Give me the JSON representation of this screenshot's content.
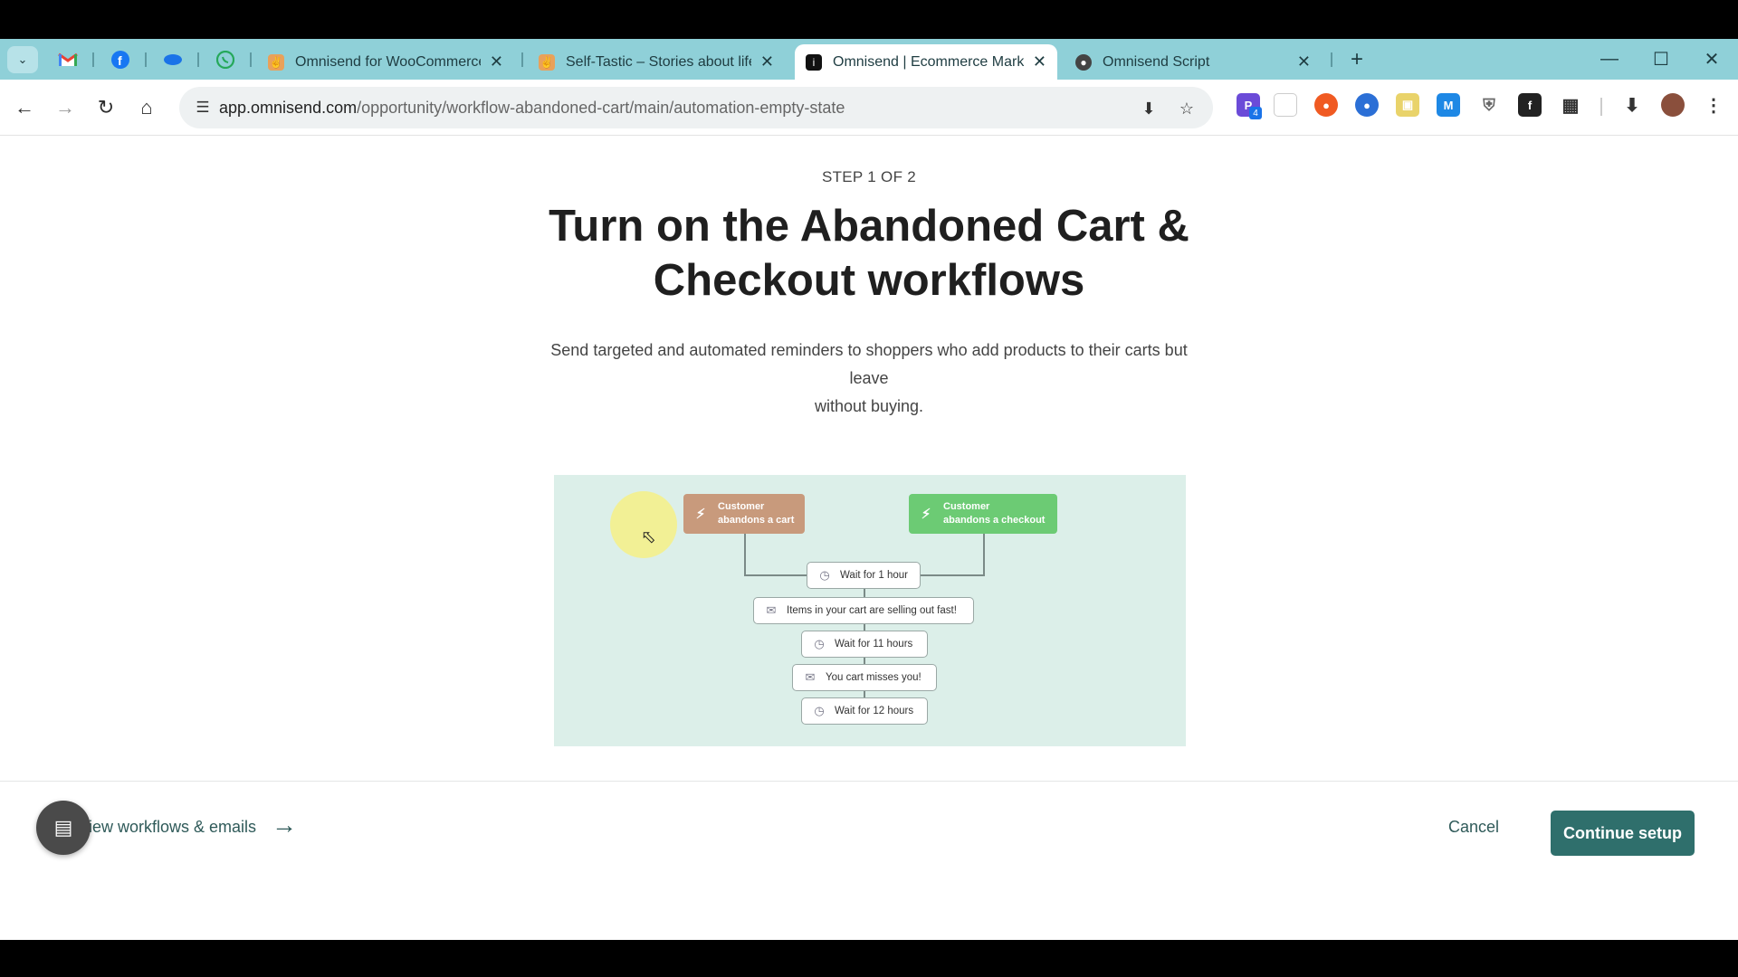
{
  "browser": {
    "tabs": [
      {
        "title": "Omnisend for WooCommerce",
        "favicon": "hand-icon",
        "active": false
      },
      {
        "title": "Self-Tastic – Stories about life i…",
        "favicon": "hand-icon",
        "active": false
      },
      {
        "title": "Omnisend | Ecommerce Market…",
        "favicon": "omnisend-icon",
        "active": true
      },
      {
        "title": "Omnisend Script",
        "favicon": "globe-icon",
        "active": false
      }
    ],
    "address": {
      "domain": "app.omnisend.com",
      "path": "/opportunity/workflow-abandoned-cart/main/automation-empty-state"
    },
    "extension_badge": "4"
  },
  "page": {
    "step": "STEP 1 OF 2",
    "headline_line1": "Turn on the Abandoned Cart &",
    "headline_line2": "Checkout workflows",
    "subtitle_line1": "Send targeted and automated reminders to shoppers who add products to their carts but leave",
    "subtitle_line2": "without buying."
  },
  "workflow": {
    "trigger_cart": {
      "line1": "Customer",
      "line2": "abandons a cart",
      "color": "#c89a7c"
    },
    "trigger_checkout": {
      "line1": "Customer",
      "line2": "abandons a checkout",
      "color": "#6ccb74"
    },
    "steps": [
      {
        "label": "Wait for 1 hour",
        "icon": "clock-icon"
      },
      {
        "label": "Items in your cart are selling out fast!",
        "icon": "mail-icon"
      },
      {
        "label": "Wait for 11 hours",
        "icon": "clock-icon"
      },
      {
        "label": "You cart misses you!",
        "icon": "mail-icon"
      },
      {
        "label": "Wait for 12 hours",
        "icon": "clock-icon"
      }
    ]
  },
  "footer": {
    "view_link": "iew workflows & emails",
    "cancel": "Cancel",
    "continue": "Continue setup"
  },
  "colors": {
    "primary_button": "#2f6f6c",
    "tabstrip": "#8fd0d8",
    "illustration_bg": "#dcefe9"
  }
}
